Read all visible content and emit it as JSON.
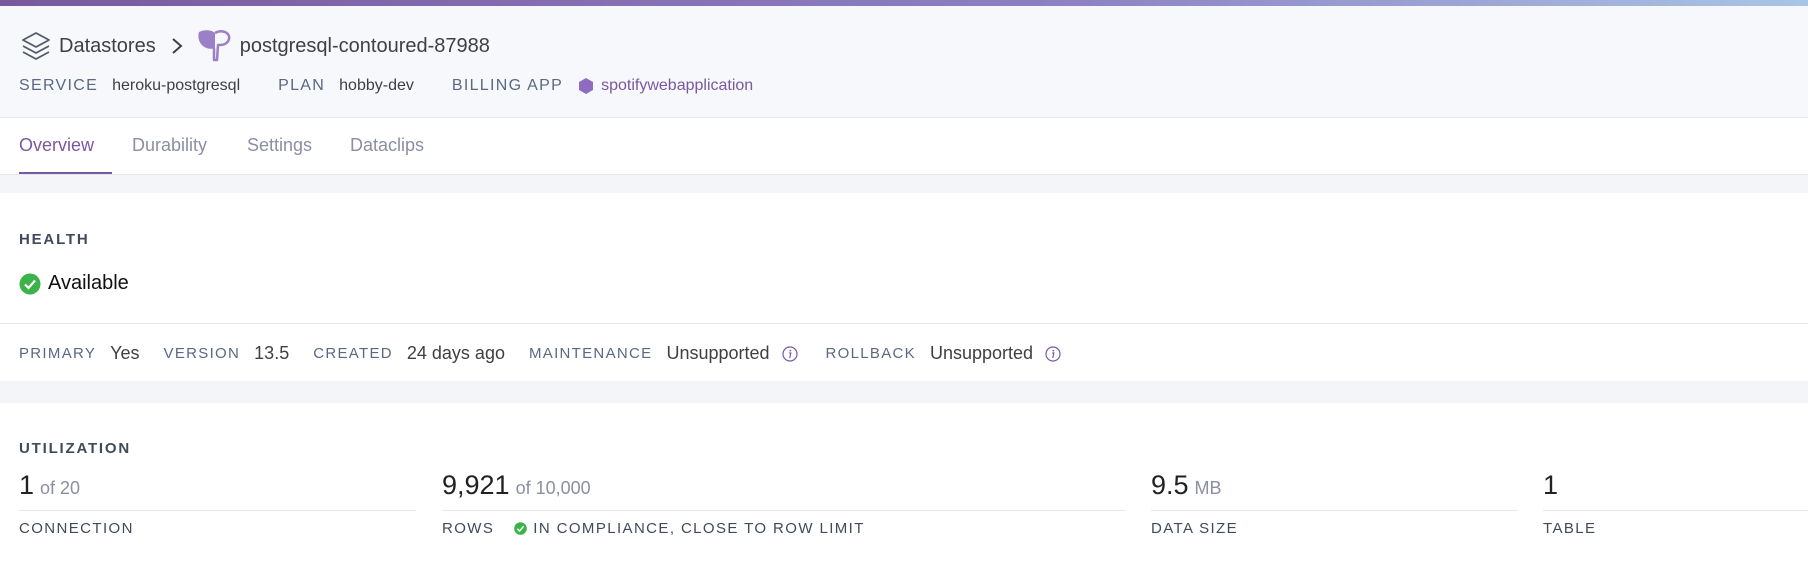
{
  "breadcrumb": {
    "root_label": "Datastores",
    "current_label": "postgresql-contoured-87988"
  },
  "meta": {
    "service_key": "SERVICE",
    "service_value": "heroku-postgresql",
    "plan_key": "PLAN",
    "plan_value": "hobby-dev",
    "billing_key": "BILLING APP",
    "billing_value": "spotifywebapplication"
  },
  "tabs": [
    {
      "label": "Overview",
      "active": true
    },
    {
      "label": "Durability",
      "active": false
    },
    {
      "label": "Settings",
      "active": false
    },
    {
      "label": "Dataclips",
      "active": false
    }
  ],
  "health": {
    "title": "HEALTH",
    "status": "Available",
    "status_color": "#3bb34a",
    "props": {
      "primary_key": "PRIMARY",
      "primary_value": "Yes",
      "version_key": "VERSION",
      "version_value": "13.5",
      "created_key": "CREATED",
      "created_value": "24 days ago",
      "maintenance_key": "MAINTENANCE",
      "maintenance_value": "Unsupported",
      "rollback_key": "ROLLBACK",
      "rollback_value": "Unsupported"
    }
  },
  "utilization": {
    "title": "UTILIZATION",
    "connection": {
      "value": "1",
      "of": "of 20",
      "label": "CONNECTION"
    },
    "rows": {
      "value": "9,921",
      "of": "of 10,000",
      "label": "ROWS",
      "note": "IN COMPLIANCE, CLOSE TO ROW LIMIT"
    },
    "data_size": {
      "value": "9.5",
      "unit": "MB",
      "label": "DATA SIZE"
    },
    "tables": {
      "value": "1",
      "label": "TABLE"
    }
  },
  "colors": {
    "accent": "#79589f",
    "ok": "#3bb34a"
  },
  "icons": {
    "datastore": "layers-icon",
    "postgres": "elephant-icon",
    "billing_app": "hexagon-icon",
    "info": "info-icon",
    "ok": "check-circle-icon"
  }
}
